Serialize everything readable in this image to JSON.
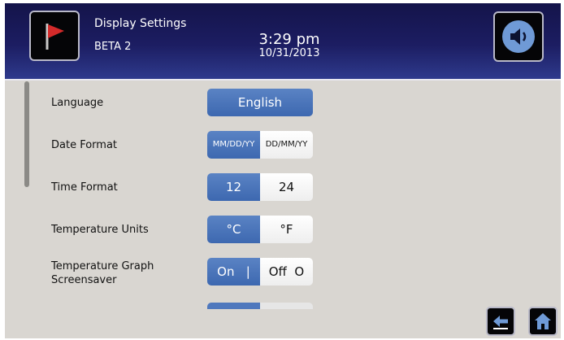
{
  "header": {
    "title": "Display Settings",
    "subtitle": "BETA 2",
    "time": "3:29 pm",
    "date": "10/31/2013"
  },
  "icons": {
    "flag": "flag-icon",
    "sound": "speaker-icon",
    "back": "back-arrow-icon",
    "home": "home-icon"
  },
  "colors": {
    "header": "#1c1d62",
    "accent": "#3d68b0",
    "background": "#d9d6d1",
    "flag": "#d42a2a"
  },
  "settings": {
    "language": {
      "label": "Language",
      "value": "English"
    },
    "date_format": {
      "label": "Date Format",
      "options": [
        "MM/DD/YY",
        "DD/MM/YY"
      ],
      "selected": "MM/DD/YY"
    },
    "time_format": {
      "label": "Time Format",
      "options": [
        "12",
        "24"
      ],
      "selected": "12"
    },
    "temperature_units": {
      "label": "Temperature Units",
      "options": [
        "°C",
        "°F"
      ],
      "selected": "°C"
    },
    "screensaver": {
      "label": "Temperature Graph Screensaver",
      "options": [
        "On   |",
        "Off  O"
      ],
      "selected": "On   |"
    }
  }
}
